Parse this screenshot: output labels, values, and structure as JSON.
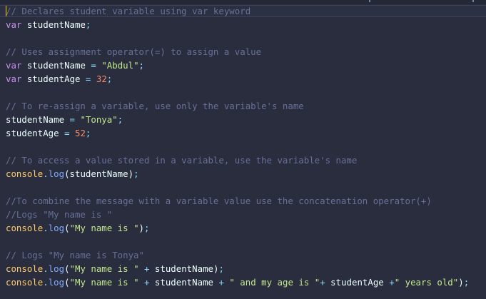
{
  "editor": {
    "lines": [
      [
        {
          "t": "comment",
          "v": "// Declares student variable using var keyword"
        }
      ],
      [
        {
          "t": "keyword",
          "v": "var"
        },
        {
          "t": "var",
          "v": " studentName"
        },
        {
          "t": "punct",
          "v": ";"
        }
      ],
      [],
      [
        {
          "t": "comment",
          "v": "// Uses assignment operator(=) to assign a value"
        }
      ],
      [
        {
          "t": "keyword",
          "v": "var"
        },
        {
          "t": "var",
          "v": " studentName "
        },
        {
          "t": "operator",
          "v": "="
        },
        {
          "t": "var",
          "v": " "
        },
        {
          "t": "string",
          "v": "\"Abdul\""
        },
        {
          "t": "punct",
          "v": ";"
        }
      ],
      [
        {
          "t": "keyword",
          "v": "var"
        },
        {
          "t": "var",
          "v": " studentAge "
        },
        {
          "t": "operator",
          "v": "="
        },
        {
          "t": "var",
          "v": " "
        },
        {
          "t": "number",
          "v": "32"
        },
        {
          "t": "punct",
          "v": ";"
        }
      ],
      [],
      [
        {
          "t": "comment",
          "v": "// To re-assign a variable, use only the variable's name"
        }
      ],
      [
        {
          "t": "var",
          "v": "studentName "
        },
        {
          "t": "operator",
          "v": "="
        },
        {
          "t": "var",
          "v": " "
        },
        {
          "t": "string",
          "v": "\"Tonya\""
        },
        {
          "t": "punct",
          "v": ";"
        }
      ],
      [
        {
          "t": "var",
          "v": "studentAge "
        },
        {
          "t": "operator",
          "v": "="
        },
        {
          "t": "var",
          "v": " "
        },
        {
          "t": "number",
          "v": "52"
        },
        {
          "t": "punct",
          "v": ";"
        }
      ],
      [],
      [
        {
          "t": "comment",
          "v": "// To access a value stored in a variable, use the variable's name"
        }
      ],
      [
        {
          "t": "object",
          "v": "console"
        },
        {
          "t": "punct",
          "v": "."
        },
        {
          "t": "method",
          "v": "log"
        },
        {
          "t": "var",
          "v": "(studentName)"
        },
        {
          "t": "punct",
          "v": ";"
        }
      ],
      [],
      [
        {
          "t": "comment",
          "v": "//To combine the message with a variable value use the concatenation operator(+)"
        }
      ],
      [
        {
          "t": "comment",
          "v": "//Logs \"My name is \""
        }
      ],
      [
        {
          "t": "object",
          "v": "console"
        },
        {
          "t": "punct",
          "v": "."
        },
        {
          "t": "method",
          "v": "log"
        },
        {
          "t": "var",
          "v": "("
        },
        {
          "t": "string",
          "v": "\"My name is \""
        },
        {
          "t": "var",
          "v": ")"
        },
        {
          "t": "punct",
          "v": ";"
        }
      ],
      [],
      [
        {
          "t": "comment",
          "v": "// Logs \"My name is Tonya\""
        }
      ],
      [
        {
          "t": "object",
          "v": "console"
        },
        {
          "t": "punct",
          "v": "."
        },
        {
          "t": "method",
          "v": "log"
        },
        {
          "t": "var",
          "v": "("
        },
        {
          "t": "string",
          "v": "\"My name is \""
        },
        {
          "t": "var",
          "v": " "
        },
        {
          "t": "operator",
          "v": "+"
        },
        {
          "t": "var",
          "v": " studentName)"
        },
        {
          "t": "punct",
          "v": ";"
        }
      ],
      [
        {
          "t": "object",
          "v": "console"
        },
        {
          "t": "punct",
          "v": "."
        },
        {
          "t": "method",
          "v": "log"
        },
        {
          "t": "var",
          "v": "("
        },
        {
          "t": "string",
          "v": "\"My name is \""
        },
        {
          "t": "var",
          "v": " "
        },
        {
          "t": "operator",
          "v": "+"
        },
        {
          "t": "var",
          "v": " studentName "
        },
        {
          "t": "operator",
          "v": "+"
        },
        {
          "t": "var",
          "v": " "
        },
        {
          "t": "string",
          "v": "\" and my age is \""
        },
        {
          "t": "operator",
          "v": "+"
        },
        {
          "t": "var",
          "v": " studentAge "
        },
        {
          "t": "operator",
          "v": "+"
        },
        {
          "t": "string",
          "v": "\" years old\""
        },
        {
          "t": "var",
          "v": ")"
        },
        {
          "t": "punct",
          "v": ";"
        }
      ]
    ]
  }
}
